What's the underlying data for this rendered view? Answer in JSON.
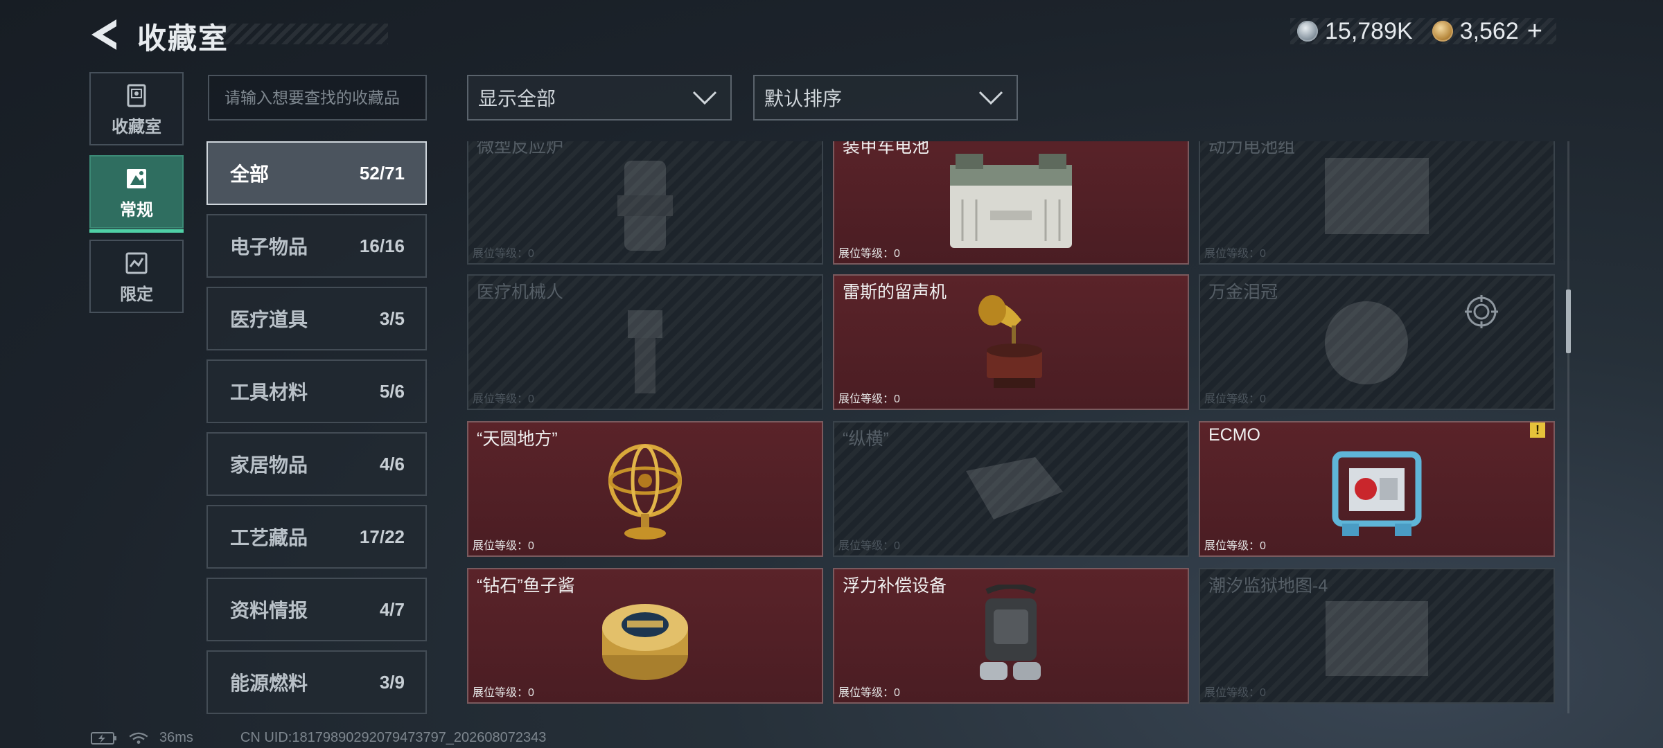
{
  "header": {
    "title": "收藏室",
    "currency": [
      {
        "icon": "silver-coin-icon",
        "value": "15,789K"
      },
      {
        "icon": "gold-coin-icon",
        "value": "3,562"
      }
    ],
    "plus": "+"
  },
  "left_tabs": [
    {
      "label": "收藏室",
      "icon": "collection-room-icon",
      "active": false
    },
    {
      "label": "常规",
      "icon": "regular-icon",
      "active": true
    },
    {
      "label": "限定",
      "icon": "limited-icon",
      "active": false
    }
  ],
  "search": {
    "placeholder": "请输入想要查找的收藏品"
  },
  "categories": [
    {
      "name": "全部",
      "count": "52/71",
      "active": true
    },
    {
      "name": "电子物品",
      "count": "16/16"
    },
    {
      "name": "医疗道具",
      "count": "3/5"
    },
    {
      "name": "工具材料",
      "count": "5/6"
    },
    {
      "name": "家居物品",
      "count": "4/6"
    },
    {
      "name": "工艺藏品",
      "count": "17/22"
    },
    {
      "name": "资料情报",
      "count": "4/7"
    },
    {
      "name": "能源燃料",
      "count": "3/9"
    }
  ],
  "filters": {
    "show": "显示全部",
    "sort": "默认排序"
  },
  "level_label": "展位等级：0",
  "items": [
    {
      "name": "微型反应炉",
      "owned": false,
      "icon": "reactor-icon"
    },
    {
      "name": "装甲车电池",
      "owned": true,
      "icon": "battery-icon"
    },
    {
      "name": "动力电池组",
      "owned": false,
      "icon": "battery-pack-icon"
    },
    {
      "name": "医疗机械人",
      "owned": false,
      "icon": "medical-robot-icon"
    },
    {
      "name": "雷斯的留声机",
      "owned": true,
      "icon": "gramophone-icon"
    },
    {
      "name": "万金泪冠",
      "owned": false,
      "icon": "crown-icon"
    },
    {
      "name": "“天圆地方”",
      "owned": true,
      "icon": "armillary-sphere-icon"
    },
    {
      "name": "“纵横”",
      "owned": false,
      "icon": "board-icon"
    },
    {
      "name": "ECMO",
      "owned": true,
      "icon": "ecmo-machine-icon",
      "warning": "!"
    },
    {
      "name": "“钻石”鱼子酱",
      "owned": true,
      "icon": "caviar-tin-icon"
    },
    {
      "name": "浮力补偿设备",
      "owned": true,
      "icon": "buoyancy-device-icon"
    },
    {
      "name": "潮汐监狱地图-4",
      "owned": false,
      "icon": "map-icon"
    }
  ],
  "footer": {
    "ping": "36ms",
    "uid": "CN UID:1817989029207947​3797_202608072343"
  }
}
